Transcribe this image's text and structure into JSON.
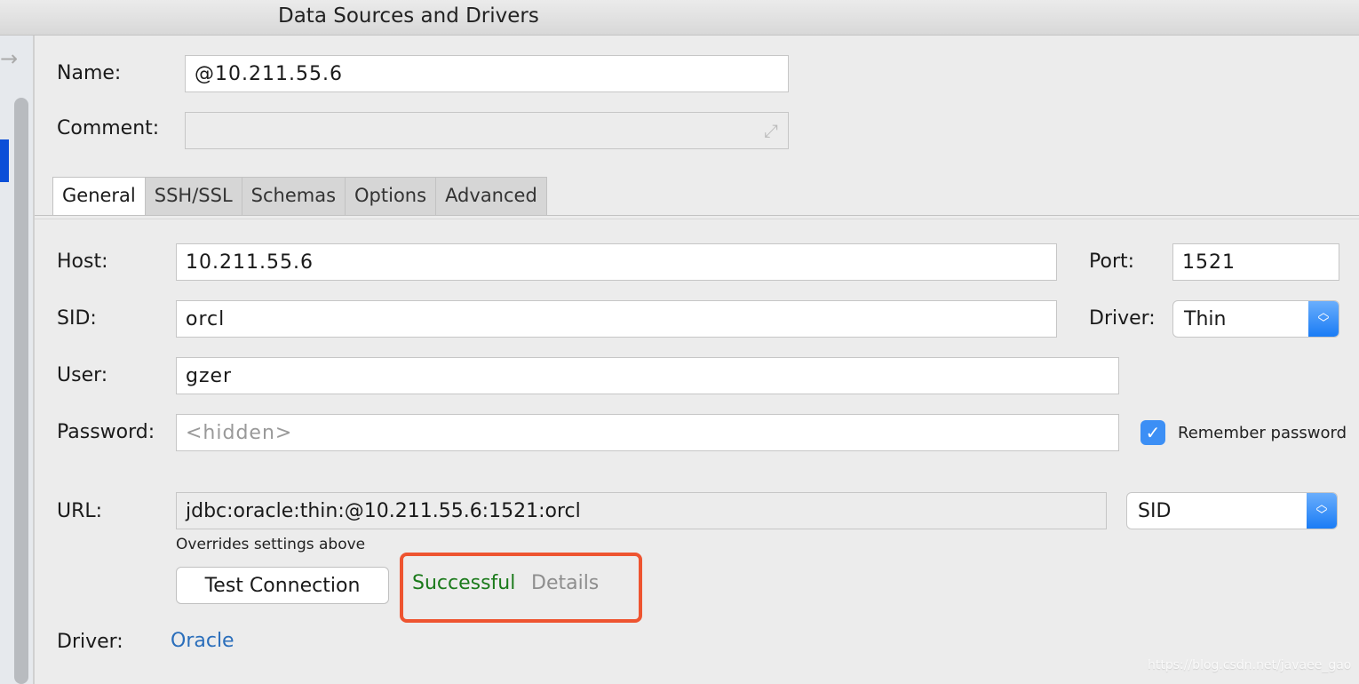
{
  "window": {
    "title": "Data Sources and Drivers"
  },
  "form": {
    "name_label": "Name:",
    "name_value": "@10.211.55.6",
    "comment_label": "Comment:",
    "comment_value": ""
  },
  "tabs": [
    {
      "label": "General",
      "active": true
    },
    {
      "label": "SSH/SSL"
    },
    {
      "label": "Schemas"
    },
    {
      "label": "Options"
    },
    {
      "label": "Advanced"
    }
  ],
  "general": {
    "host_label": "Host:",
    "host_value": "10.211.55.6",
    "port_label": "Port:",
    "port_value": "1521",
    "sid_label": "SID:",
    "sid_value": "orcl",
    "driver_label": "Driver:",
    "driver_value": "Thin",
    "user_label": "User:",
    "user_value": "gzer",
    "password_label": "Password:",
    "password_placeholder": "<hidden>",
    "remember_label": "Remember password",
    "remember_checked": true,
    "url_label": "URL:",
    "url_value": "jdbc:oracle:thin:@10.211.55.6:1521:orcl",
    "url_type": "SID",
    "url_note": "Overrides settings above",
    "test_button": "Test Connection",
    "status": "Successful",
    "status_color": "#1b7a1b",
    "details": "Details",
    "driver_link_label": "Driver:",
    "driver_link": "Oracle"
  },
  "colors": {
    "accent": "#1a7cf5",
    "highlight": "#ee5430",
    "link": "#2a6ebb"
  },
  "watermark": "https://blog.csdn.net/javaee_gao"
}
